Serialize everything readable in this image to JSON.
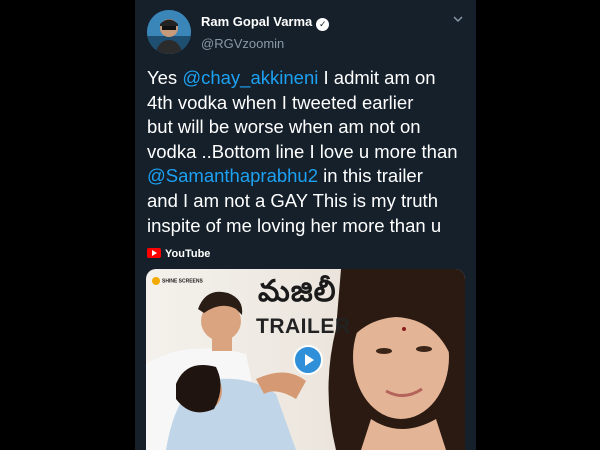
{
  "author": {
    "name": "Ram Gopal Varma",
    "handle": "@RGVzoomin"
  },
  "tweet": {
    "lines": [
      [
        {
          "text": "Yes ",
          "mention": false
        },
        {
          "text": "@chay_akkineni",
          "mention": true
        },
        {
          "text": " I admit am on",
          "mention": false
        }
      ],
      [
        {
          "text": "4th vodka when I tweeted earlier",
          "mention": false
        }
      ],
      [
        {
          "text": "but will be worse when am not on",
          "mention": false
        }
      ],
      [
        {
          "text": "vodka ..Bottom line I love u more than",
          "mention": false
        }
      ],
      [
        {
          "text": "@Samanthaprabhu2",
          "mention": true
        },
        {
          "text": " in this trailer",
          "mention": false
        }
      ],
      [
        {
          "text": "and I am not a GAY This is my truth",
          "mention": false
        }
      ],
      [
        {
          "text": "inspite of me loving her more than u",
          "mention": false
        }
      ]
    ]
  },
  "link_card": {
    "source": "YouTube",
    "brand": "SHINE SCREENS",
    "movie_title": "మజిలీ",
    "label": "TRAILER"
  },
  "colors": {
    "background": "#15202b",
    "mention": "#1da1f2",
    "secondary_text": "#8899a6",
    "youtube_red": "#ff0000",
    "play_blue": "#2f8fd8"
  },
  "icons": {
    "verified": "verified-badge-icon",
    "more": "chevron-down-icon",
    "source": "youtube-icon",
    "play": "play-icon"
  }
}
